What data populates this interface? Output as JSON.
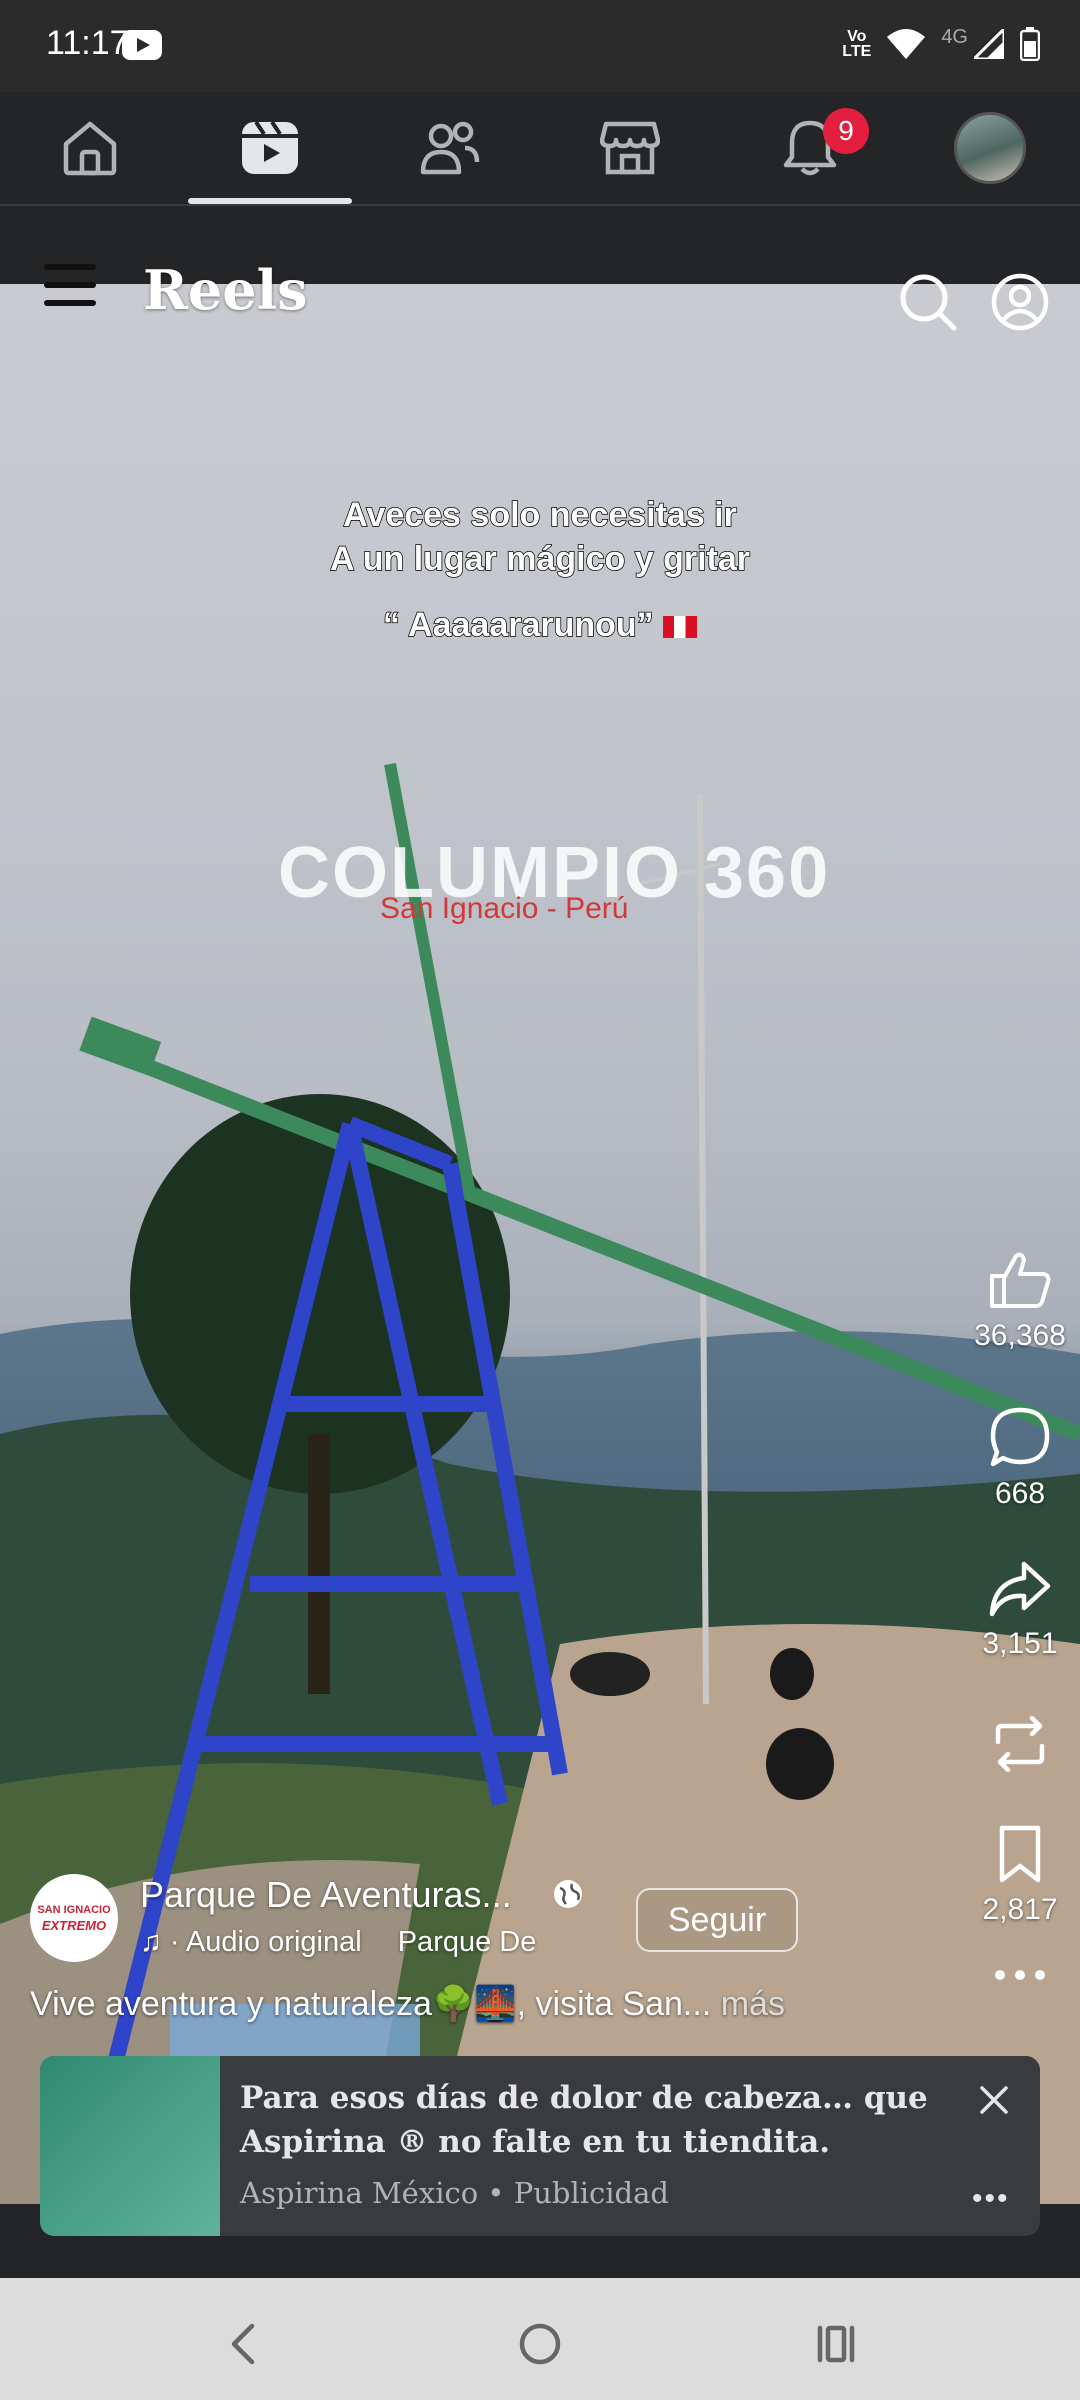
{
  "status_bar": {
    "time": "11:17",
    "volte_label": "Vo\nLTE",
    "network_label": "4G",
    "icons": [
      "youtube-icon",
      "volte-icon",
      "wifi-icon",
      "signal-icon",
      "battery-icon"
    ]
  },
  "top_nav": {
    "items": [
      "home-icon",
      "reels-icon",
      "friends-icon",
      "marketplace-icon",
      "notifications-icon",
      "profile-avatar"
    ],
    "active": "reels-icon",
    "notification_count": "9"
  },
  "header": {
    "title": "Reels",
    "icons": [
      "menu-icon",
      "search-icon",
      "profile-icon"
    ]
  },
  "video": {
    "overlay_lines": [
      "Aveces solo necesitas ir",
      "A un lugar mágico y gritar",
      "“ Aaaaararunou”"
    ],
    "watermark_title": "COLUMPIO 360",
    "watermark_subtitle": "San Ignacio - Perú"
  },
  "actions": {
    "likes": "36,368",
    "comments": "668",
    "shares": "3,151",
    "saves": "2,817"
  },
  "owner": {
    "page_name": "Parque De Aventuras...",
    "avatar_text_line1": "SAN IGNACIO",
    "avatar_text_line2": "EXTREMO",
    "audio_label": "· Audio original",
    "audio_owner": "Parque De",
    "follow_label": "Seguir"
  },
  "caption": {
    "text": "Vive aventura y naturaleza🌳🌉, visita San...",
    "more_label": "más"
  },
  "ad": {
    "title": "Para esos días de dolor de cabeza… que Aspirina ® no falte en tu tiendita.",
    "sponsor": "Aspirina México • Publicidad",
    "more_label": "•••"
  },
  "colors": {
    "app_background": "#242526",
    "notification_badge": "#e41e3f",
    "ad_thumb": "#2f8a6e",
    "swing_blue": "#2f45c9",
    "swing_arm_green": "#3c8a5c"
  }
}
